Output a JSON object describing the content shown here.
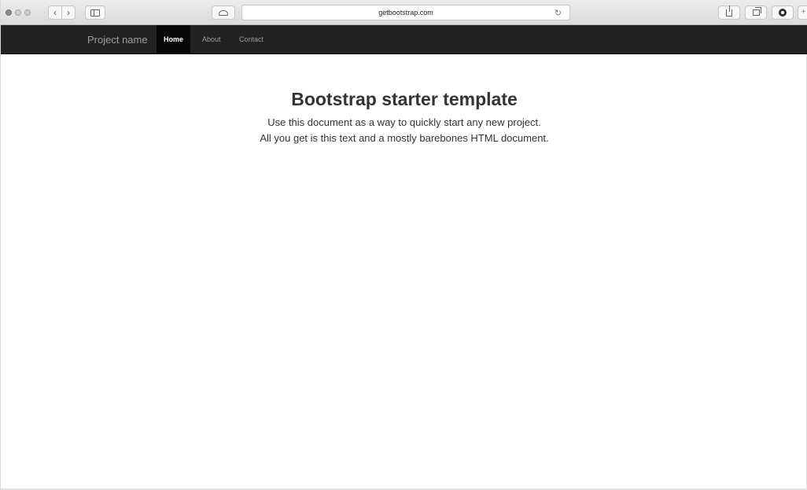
{
  "browser": {
    "url": "getbootstrap.com",
    "icons": {
      "back": "chevron-left",
      "forward": "chevron-right",
      "sidebar": "sidebar-toggle",
      "cloud": "icloud-tabs",
      "reload": "reload",
      "share": "share",
      "tabs": "show-all-tabs",
      "extension": "extension",
      "new_tab": "new-tab"
    }
  },
  "navbar": {
    "brand": "Project name",
    "items": [
      {
        "label": "Home",
        "active": true
      },
      {
        "label": "About",
        "active": false
      },
      {
        "label": "Contact",
        "active": false
      }
    ],
    "colors": {
      "background": "#222222",
      "active_background": "#080808",
      "link": "#9d9d9d",
      "active_link": "#ffffff"
    }
  },
  "main": {
    "heading": "Bootstrap starter template",
    "lead_line1": "Use this document as a way to quickly start any new project.",
    "lead_line2": "All you get is this text and a mostly barebones HTML document."
  }
}
